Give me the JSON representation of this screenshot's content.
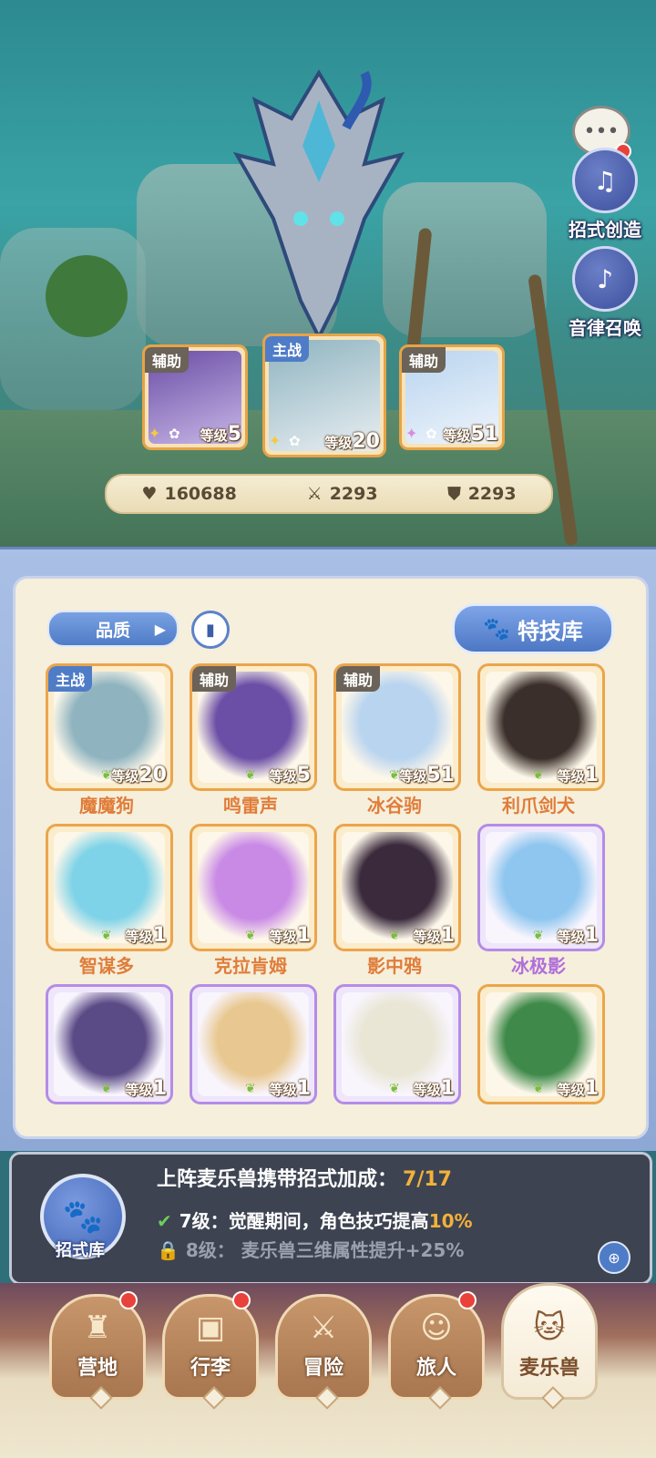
{
  "side_buttons": [
    {
      "label": "招式创造",
      "icon": "music-box-icon"
    },
    {
      "label": "音律召唤",
      "icon": "lyre-icon"
    }
  ],
  "team": [
    {
      "role": "辅助",
      "level_prefix": "等级",
      "level": "5"
    },
    {
      "role": "主战",
      "level_prefix": "等级",
      "level": "20"
    },
    {
      "role": "辅助",
      "level_prefix": "等级",
      "level": "51"
    }
  ],
  "stats": {
    "hp": "160688",
    "attack": "2293",
    "defense": "2293"
  },
  "panel": {
    "quality_label": "品质",
    "skill_library_label": "特技库"
  },
  "pets": [
    {
      "name": "魔魔狗",
      "tag": "主战",
      "level": "20",
      "rarity": "orange",
      "color": "#8fb4c0"
    },
    {
      "name": "鸣雷声",
      "tag": "辅助",
      "level": "5",
      "rarity": "orange",
      "color": "#6b4ea6"
    },
    {
      "name": "冰谷驹",
      "tag": "辅助",
      "level": "51",
      "rarity": "orange",
      "color": "#b9d4ef"
    },
    {
      "name": "利爪剑犬",
      "tag": "",
      "level": "1",
      "rarity": "orange",
      "color": "#3a2f2a"
    },
    {
      "name": "智谋多",
      "tag": "",
      "level": "1",
      "rarity": "orange",
      "color": "#7fd3e8"
    },
    {
      "name": "克拉肯姆",
      "tag": "",
      "level": "1",
      "rarity": "orange",
      "color": "#c98ae6"
    },
    {
      "name": "影中鸦",
      "tag": "",
      "level": "1",
      "rarity": "orange",
      "color": "#3a2a3c"
    },
    {
      "name": "冰极影",
      "tag": "",
      "level": "1",
      "rarity": "purple",
      "color": "#8fc6ef"
    },
    {
      "name": "",
      "tag": "",
      "level": "1",
      "rarity": "purple",
      "color": "#5a4a86"
    },
    {
      "name": "",
      "tag": "",
      "level": "1",
      "rarity": "purple",
      "color": "#e8c890"
    },
    {
      "name": "",
      "tag": "",
      "level": "1",
      "rarity": "purple",
      "color": "#e9e6d6"
    },
    {
      "name": "",
      "tag": "",
      "level": "1",
      "rarity": "orange",
      "color": "#3f8a4a"
    }
  ],
  "level_prefix": "等级",
  "bonus": {
    "title": "上阵麦乐兽携带招式加成：",
    "progress": "7/17",
    "icon_label": "招式库",
    "line1_level": "7级：",
    "line1_text": "觉醒期间，角色技巧提高",
    "line1_value": "10%",
    "line2": "8级：  麦乐兽三维属性提升+25%"
  },
  "nav": [
    {
      "label": "营地",
      "icon": "castle-icon",
      "badge": true
    },
    {
      "label": "行李",
      "icon": "backpack-icon",
      "badge": true
    },
    {
      "label": "冒险",
      "icon": "swords-icon",
      "badge": false
    },
    {
      "label": "旅人",
      "icon": "traveler-icon",
      "badge": true
    },
    {
      "label": "麦乐兽",
      "icon": "pet-icon",
      "badge": false
    }
  ],
  "colors": {
    "accent_blue": "#4f7cc7",
    "orange_frame": "#eba54c",
    "purple_frame": "#b48ce6",
    "badge_red": "#e9423a"
  }
}
